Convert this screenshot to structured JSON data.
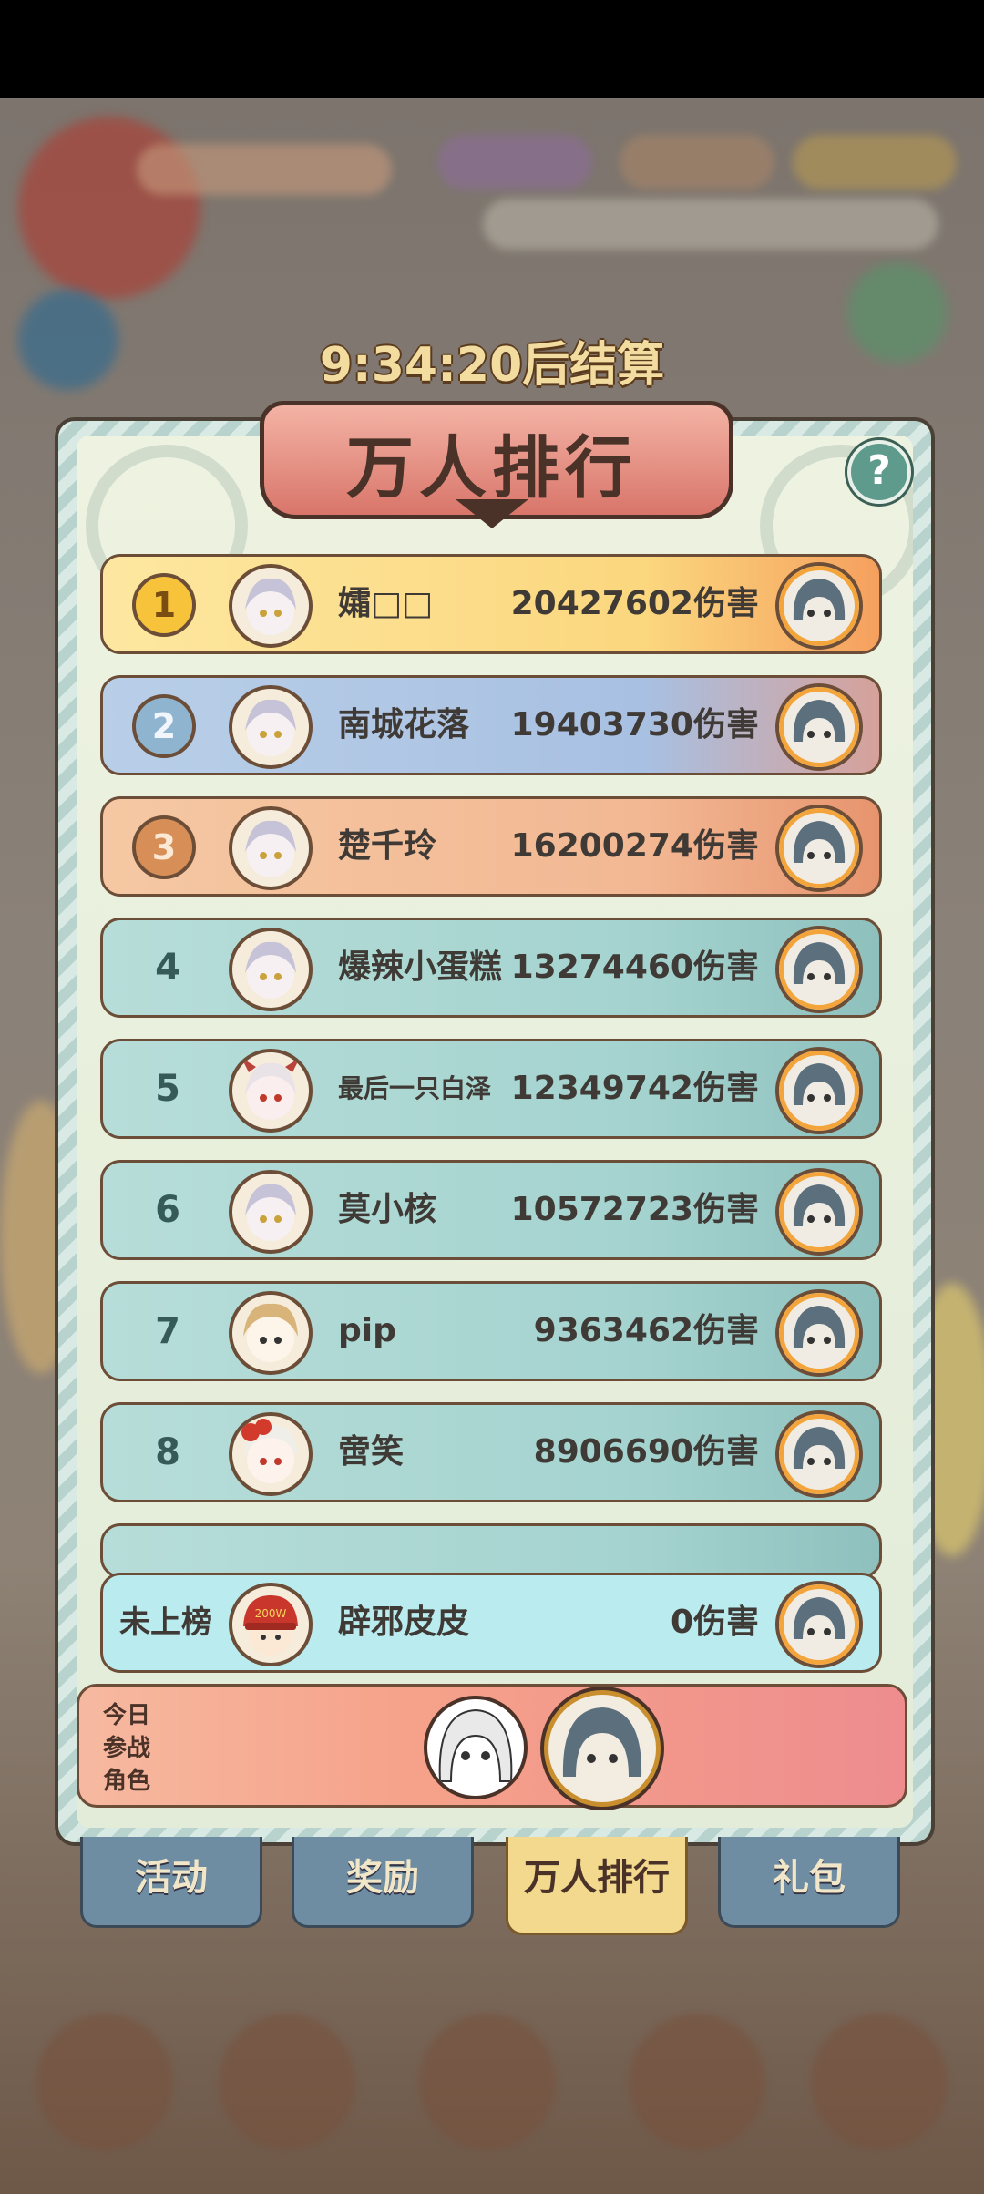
{
  "timer": "9:34:20后结算",
  "title": "万人排行",
  "help_icon": "?",
  "rows": [
    {
      "rank": "1",
      "name": "孀□□",
      "damage": "20427602伤害",
      "style": "gold"
    },
    {
      "rank": "2",
      "name": "南城花落",
      "damage": "19403730伤害",
      "style": "silver"
    },
    {
      "rank": "3",
      "name": "楚千玲",
      "damage": "16200274伤害",
      "style": "bronze"
    },
    {
      "rank": "4",
      "name": "爆辣小蛋糕",
      "damage": "13274460伤害",
      "style": "teal"
    },
    {
      "rank": "5",
      "name": "最后一只白泽",
      "damage": "12349742伤害",
      "style": "teal"
    },
    {
      "rank": "6",
      "name": "莫小核",
      "damage": "10572723伤害",
      "style": "teal"
    },
    {
      "rank": "7",
      "name": "pip",
      "damage": "9363462伤害",
      "style": "teal"
    },
    {
      "rank": "8",
      "name": "啻笑",
      "damage": "8906690伤害",
      "style": "teal"
    }
  ],
  "my_row": {
    "label": "未上榜",
    "name": "辟邪皮皮",
    "damage": "0伤害"
  },
  "today": {
    "line1": "今日",
    "line2": "参战",
    "line3": "角色"
  },
  "tabs": [
    {
      "label": "活动",
      "active": false
    },
    {
      "label": "奖励",
      "active": false
    },
    {
      "label": "万人排行",
      "active": true
    },
    {
      "label": "礼包",
      "active": false
    }
  ]
}
